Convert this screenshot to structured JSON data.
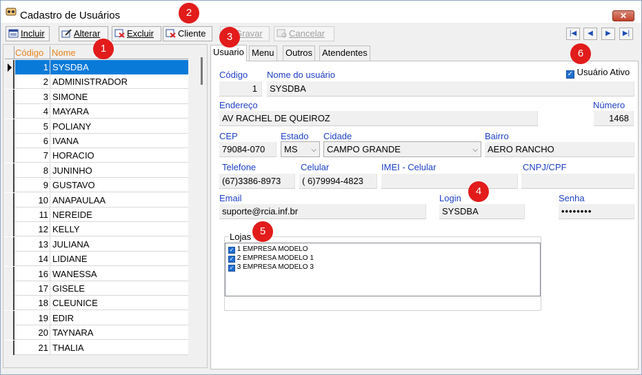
{
  "window": {
    "title": "Cadastro de Usuários",
    "close_icon": "close-icon"
  },
  "toolbar": {
    "incluir": "Incluir",
    "alterar": "Alterar",
    "excluir": "Excluir",
    "cliente": "Cliente",
    "gravar": "Gravar",
    "cancelar": "Cancelar",
    "nav": {
      "first": "⏮",
      "prev": "◀",
      "next": "▶",
      "last": "⏭"
    }
  },
  "grid": {
    "headers": {
      "codigo": "Código",
      "nome": "Nome"
    },
    "rows": [
      {
        "codigo": "1",
        "nome": "SYSDBA"
      },
      {
        "codigo": "2",
        "nome": "ADMINISTRADOR"
      },
      {
        "codigo": "3",
        "nome": "SIMONE"
      },
      {
        "codigo": "4",
        "nome": "MAYARA"
      },
      {
        "codigo": "5",
        "nome": "POLIANY"
      },
      {
        "codigo": "6",
        "nome": "IVANA"
      },
      {
        "codigo": "7",
        "nome": "HORACIO"
      },
      {
        "codigo": "8",
        "nome": "JUNINHO"
      },
      {
        "codigo": "9",
        "nome": "GUSTAVO"
      },
      {
        "codigo": "10",
        "nome": "ANAPAULAA"
      },
      {
        "codigo": "11",
        "nome": "NEREIDE"
      },
      {
        "codigo": "12",
        "nome": "KELLY"
      },
      {
        "codigo": "13",
        "nome": "JULIANA"
      },
      {
        "codigo": "14",
        "nome": "LIDIANE"
      },
      {
        "codigo": "16",
        "nome": "WANESSA"
      },
      {
        "codigo": "17",
        "nome": "GISELE"
      },
      {
        "codigo": "18",
        "nome": "CLEUNICE"
      },
      {
        "codigo": "19",
        "nome": "EDIR"
      },
      {
        "codigo": "20",
        "nome": "TAYNARA"
      },
      {
        "codigo": "21",
        "nome": "THALIA"
      }
    ]
  },
  "tabs": [
    "Usuario",
    "Menu",
    "Outros",
    "Atendentes"
  ],
  "form": {
    "usuario_ativo": "Usuário Ativo",
    "codigo_label": "Código",
    "codigo": "1",
    "nome_label": "Nome do usuário",
    "nome": "SYSDBA",
    "endereco_label": "Endereço",
    "endereco": "AV RACHEL DE QUEIROZ",
    "numero_label": "Número",
    "numero": "1468",
    "cep_label": "CEP",
    "cep": "79084-070",
    "estado_label": "Estado",
    "estado": "MS",
    "cidade_label": "Cidade",
    "cidade": "CAMPO GRANDE",
    "bairro_label": "Bairro",
    "bairro": "AERO RANCHO",
    "telefone_label": "Telefone",
    "telefone": "(67)3386-8973",
    "celular_label": "Celular",
    "celular": "( 6)79994-4823",
    "imei_label": "IMEI - Celular",
    "imei": "",
    "cnpj_label": "CNPJ/CPF",
    "cnpj": "",
    "email_label": "Email",
    "email": "suporte@rcia.inf.br",
    "login_label": "Login",
    "login": "SYSDBA",
    "senha_label": "Senha",
    "senha": "••••••••"
  },
  "lojas": {
    "title": "Lojas",
    "items": [
      "1 EMPRESA MODELO",
      "2 EMPRESA MODELO 1",
      "3 EMPRESA MODELO 3"
    ]
  },
  "badges": [
    "1",
    "2",
    "3",
    "4",
    "5",
    "6"
  ],
  "colors": {
    "accent": "#0a7ad8",
    "label_blue": "#1c3fc4",
    "header_orange": "#e8821c",
    "badge_red": "#e21b1b"
  }
}
